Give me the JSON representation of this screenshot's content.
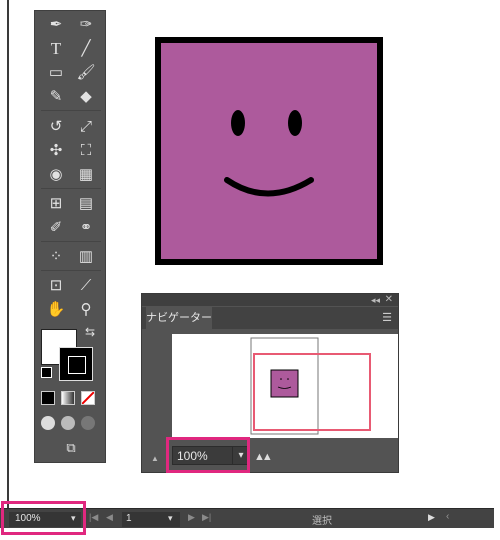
{
  "tools": {
    "icons": [
      "pen-icon",
      "curvature-icon",
      "type-icon",
      "line-segment-icon",
      "rectangle-icon",
      "paintbrush-icon",
      "shaper-icon",
      "eraser-icon",
      "rotate-icon",
      "scale-icon",
      "puppet-warp-icon",
      "free-transform-icon",
      "shape-builder-icon",
      "perspective-grid-icon",
      "mesh-icon",
      "gradient-icon",
      "eyedropper-icon",
      "blend-icon",
      "symbol-sprayer-icon",
      "column-graph-icon",
      "artboard-icon",
      "slice-icon",
      "hand-icon",
      "zoom-icon"
    ],
    "fill_color": "#ffffff",
    "stroke_color": "#000000"
  },
  "artwork": {
    "face_fill": "#ad5a9c",
    "outline_color": "#000000"
  },
  "navigator": {
    "tab_label": "ナビゲーター",
    "zoom_value": "100%",
    "view_box_color": "#e85a73"
  },
  "statusbar": {
    "zoom_value": "100%",
    "page_value": "1",
    "status_text": "選択"
  },
  "highlight_color": "#e0287f"
}
